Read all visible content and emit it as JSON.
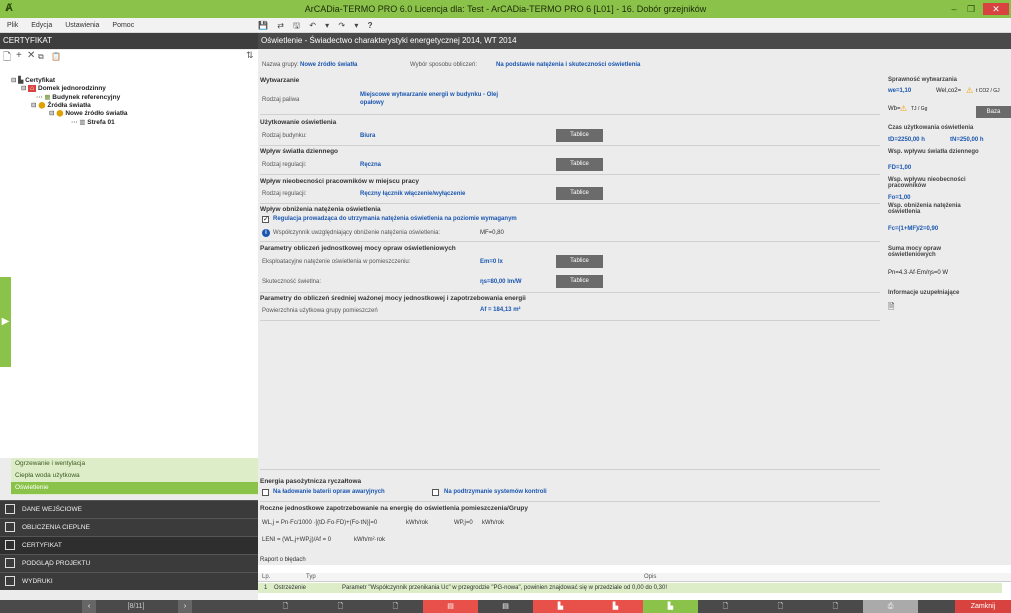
{
  "titlebar": {
    "title": "ArCADia-TERMO PRO 6.0 Licencja dla: Test - ArCADia-TERMO PRO 6 [L01] - 16. Dobór grzejników",
    "min": "–",
    "max": "❐",
    "close": "✕"
  },
  "menu": {
    "items": [
      "Plik",
      "Edycja",
      "Ustawienia",
      "Pomoc"
    ]
  },
  "toolbar": {
    "icons": [
      "💾",
      "⇄",
      "🖫",
      "↶",
      "▾",
      "↷",
      "▾",
      "?"
    ]
  },
  "left": {
    "header": "CERTYFIKAT",
    "tree": [
      {
        "label": "Certyfikat",
        "level": 0
      },
      {
        "label": "Domek jednorodzinny",
        "level": 1
      },
      {
        "label": "Budynek referencyjny",
        "level": 2
      },
      {
        "label": "Źródła światła",
        "level": 2
      },
      {
        "label": "Nowe źródło światła",
        "level": 3
      },
      {
        "label": "Strefa 01",
        "level": 4
      }
    ],
    "submenu": [
      "Ogrzewanie i wentylacja",
      "Ciepła woda użytkowa",
      "Oświetlenie"
    ],
    "nav": [
      "DANE WEJŚCIOWE",
      "OBLICZENIA CIEPLNE",
      "CERTYFIKAT",
      "PODGLĄD PROJEKTU",
      "WYDRUKI"
    ],
    "pager": "[8/11]"
  },
  "main": {
    "header": "Oświetlenie - Świadectwo charakterystyki energetycznej 2014, WT 2014",
    "group_label": "Nazwa grupy:",
    "group_value": "Nowe źródło światła",
    "method_label": "Wybór sposobu obliczeń:",
    "method_value": "Na podstawie natężenia i skuteczności oświetlenia",
    "wytwarzanie": "Wytwarzanie",
    "paliwo_label": "Rodzaj paliwa",
    "paliwo_value1": "Miejscowe wytwarzanie energii w budynku - Olej",
    "paliwo_value2": "opałowy",
    "uzytkowanie": "Użytkowanie oświetlenia",
    "budynek_label": "Rodzaj budynku:",
    "budynek_value": "Biura",
    "wplyw_dzienne": "Wpływ światła dziennego",
    "regulacja_label": "Rodzaj regulacji:",
    "regulacja_value": "Ręczna",
    "wplyw_nieobecnosci": "Wpływ nieobecności pracowników w miejscu pracy",
    "regulacja2_label": "Rodzaj regulacji:",
    "regulacja2_value": "Ręczny łącznik włączenie/wyłączenie",
    "wplyw_obnizenia": "Wpływ obniżenia natężenia oświetlenia",
    "regulacja_check": "Regulacja prowadząca do utrzymania natężenia oświetlenia na poziomie wymaganym",
    "mf_label": "Współczynnik uwzględniający obniżenie natężenia oświetlenia:",
    "mf_value": "MF=0,80",
    "parametry_mocy": "Parametry obliczeń jednostkowej mocy opraw oświetleniowych",
    "eksploatacyjne_label": "Eksploatacyjne natężenie oświetlenia w pomieszczeniu:",
    "em_value": "Em=0 lx",
    "skutecznosc_label": "Skuteczność świetlna:",
    "eta_value": "ηs=80,00 lm/W",
    "parametry_sredniej": "Parametry do obliczeń średniej ważonej mocy jednostkowej i zapotrzebowania energii",
    "powierzchnia_label": "Powierzchnia użytkowa grupy pomieszczeń",
    "powierzchnia_value": "Af = 184,13 m²",
    "tablice": "Tablice",
    "energia_pas": "Energia pasożytnicza ryczałtowa",
    "chk_baterii": "Na ładowanie baterii opraw awaryjnych",
    "chk_systemow": "Na podtrzymanie systemów kontroli",
    "roczne": "Roczne jednostkowe zapotrzebowanie na energię do oświetlenia pomieszczenia/Grupy",
    "wlj": "WL,j = Pn·Fc/1000 ·[(tD·Fo·FD)+(Fo·tN)]=0",
    "wlj_unit": "kWh/rok",
    "wpj": "WP,j=0",
    "wpj_unit": "kWh/rok",
    "leni": "LENI = (WL,j+WP,j)/Af = 0",
    "leni_unit": "kWh/m²·rok",
    "raport_title": "Raport o błędach",
    "raport_cols": [
      "Lp.",
      "Typ",
      "Opis"
    ],
    "raport_rows": [
      {
        "lp": "1",
        "typ": "Ostrzeżenie",
        "opis": "Parametr \"Współczynnik przenikania Uc\" w przegrodzie \"PG-nowa\", powinien znajdować się w przedziale od 0,00 do 0,30!"
      }
    ]
  },
  "right": {
    "sprawnosc": "Sprawność wytwarzania",
    "we": "we=1,10",
    "wel": "Wel,co2=",
    "wel_frac": "t CO2 / GJ",
    "wb": "Wb=",
    "wb_frac": "TJ / Gg",
    "baza": "Baza",
    "czas": "Czas użytkowania oświetlenia",
    "td": "tD=2250,00 h",
    "tn": "tN=250,00 h",
    "wsp_dzienne": "Wsp. wpływu światła dziennego",
    "fd": "FD=1,00",
    "wsp_nieob": "Wsp. wpływu nieobecności pracowników",
    "fo": "Fo=1,00",
    "wsp_obniz": "Wsp. obniżenia natężenia oświetlenia",
    "fc": "Fc=(1+MF)/2=0,90",
    "suma": "Suma mocy opraw oświetleniowych",
    "pn": "Pn=4.3·Af·Em/ηs=0 W",
    "info": "Informacje uzupełniające"
  },
  "colors": {
    "accent": "#8bc34a",
    "link": "#1a56b0",
    "dark": "#3b3b3b",
    "warn": "#f5c518",
    "red": "#e8504a"
  }
}
